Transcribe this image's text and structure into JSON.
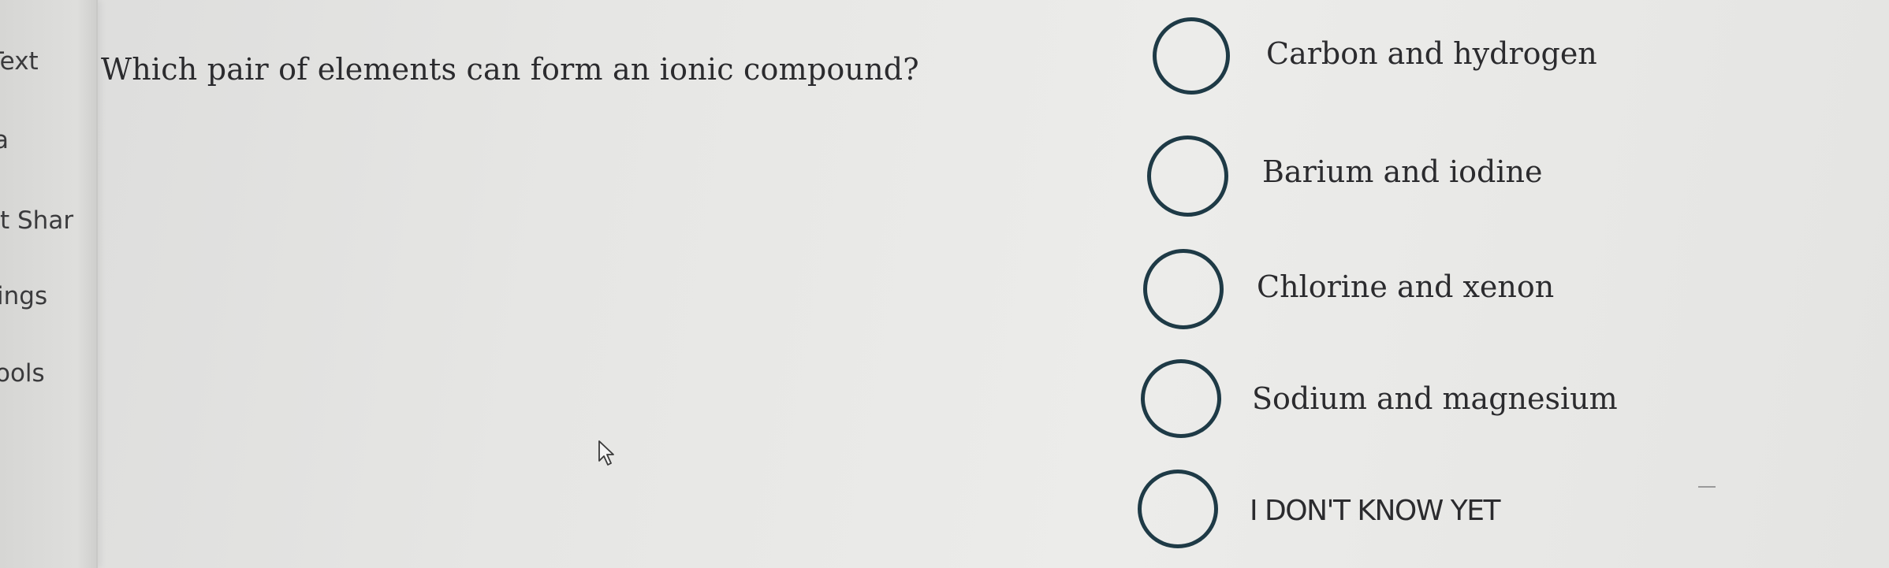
{
  "sidebar": {
    "items": [
      {
        "label": "Text"
      },
      {
        "label": "a"
      },
      {
        "label": "t Shar"
      },
      {
        "label": "ings"
      },
      {
        "label": "ools"
      }
    ]
  },
  "question": {
    "text": "Which pair of elements can form an ionic compound?"
  },
  "options": [
    {
      "label": "Carbon and hydrogen",
      "selected": false
    },
    {
      "label": "Barium and iodine",
      "selected": false
    },
    {
      "label": "Chlorine and xenon",
      "selected": false
    },
    {
      "label": "Sodium and magnesium",
      "selected": false
    },
    {
      "label": "I DON'T KNOW YET",
      "selected": false
    }
  ],
  "colors": {
    "radio_border": "#1e3a46",
    "text": "#2b2b2e"
  },
  "icons": {
    "cursor": "mouse-pointer-arrow"
  }
}
